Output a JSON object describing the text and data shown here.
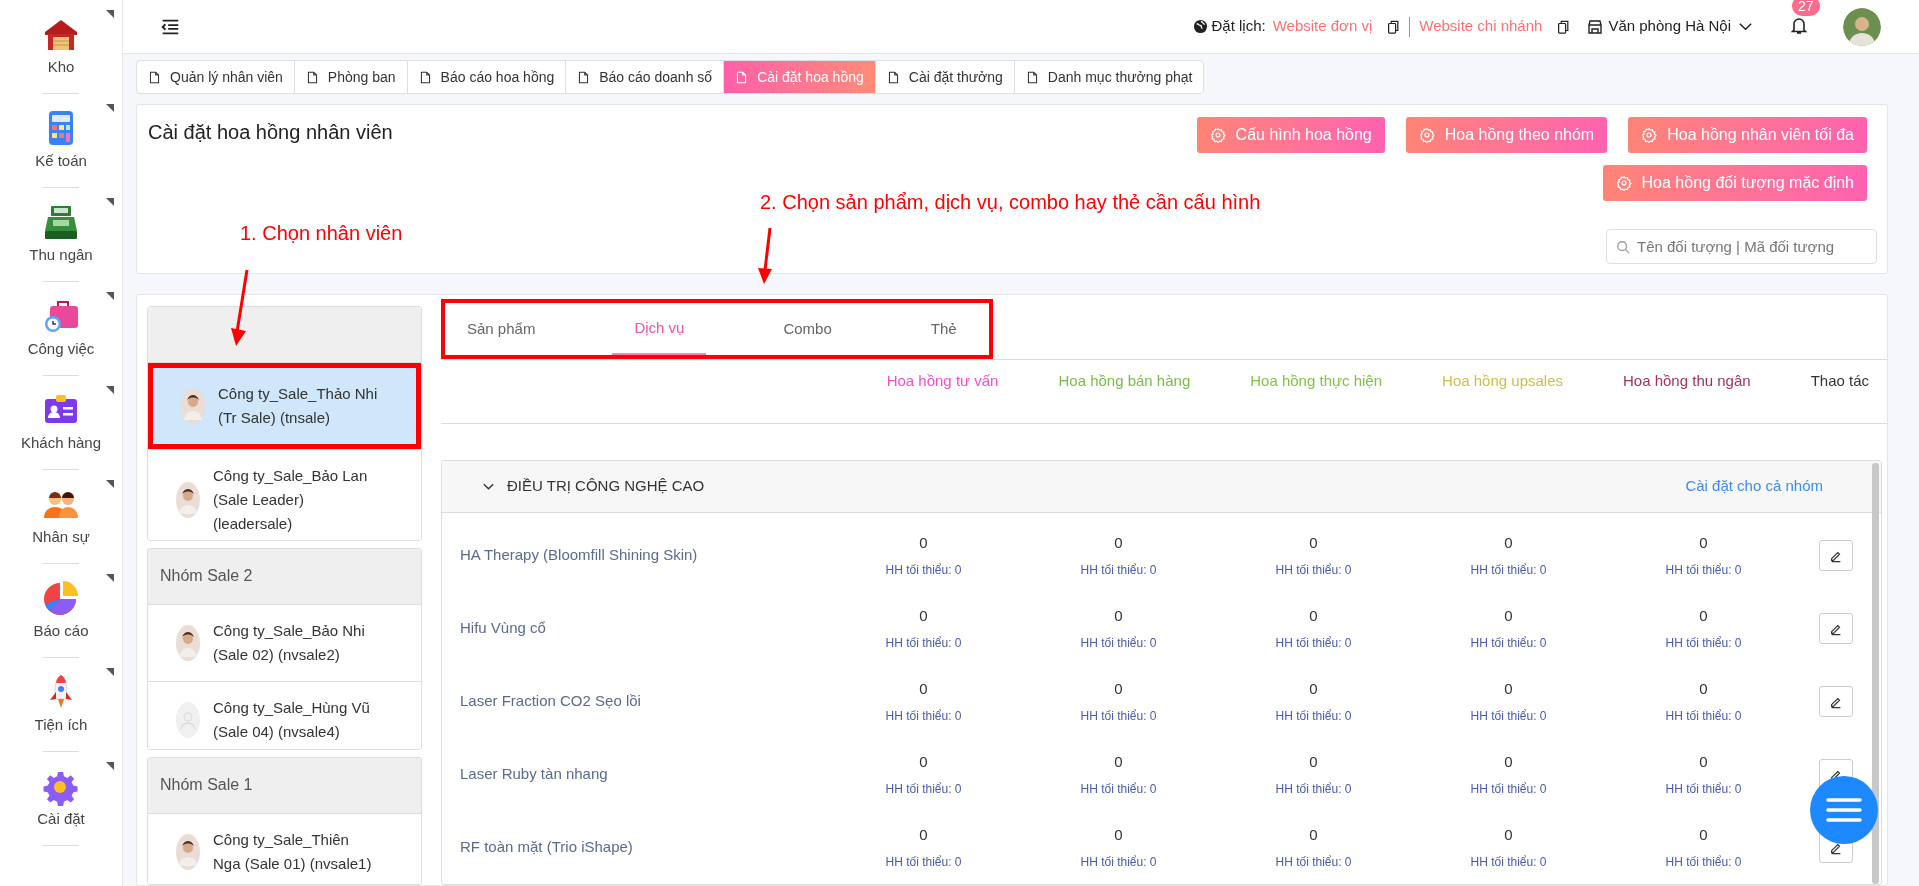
{
  "sidebar": {
    "items": [
      {
        "label": "Kho"
      },
      {
        "label": "Kế toán"
      },
      {
        "label": "Thu ngân"
      },
      {
        "label": "Công việc"
      },
      {
        "label": "Khách hàng"
      },
      {
        "label": "Nhân sự"
      },
      {
        "label": "Báo cáo"
      },
      {
        "label": "Tiện ích"
      },
      {
        "label": "Cài đặt"
      }
    ]
  },
  "topbar": {
    "booking_label": "Đặt lịch:",
    "links": [
      "Website đơn vị",
      "Website chi nhánh"
    ],
    "office": "Văn phòng Hà Nội",
    "notification_count": "27"
  },
  "tabs": [
    {
      "label": "Quản lý nhân viên",
      "selected": false
    },
    {
      "label": "Phòng ban",
      "selected": false
    },
    {
      "label": "Báo cáo hoa hồng",
      "selected": false
    },
    {
      "label": "Báo cáo doanh số",
      "selected": false
    },
    {
      "label": "Cài đặt hoa hồng",
      "selected": true
    },
    {
      "label": "Cài đặt thưởng",
      "selected": false
    },
    {
      "label": "Danh mục thưởng phạt",
      "selected": false
    }
  ],
  "header": {
    "title": "Cài đặt hoa hồng nhân viên",
    "buttons": [
      [
        "Cấu hình hoa hồng",
        "Hoa hồng theo nhóm",
        "Hoa hồng nhân viên tối đa"
      ],
      [
        "Hoa hồng đối tượng mặc định"
      ]
    ],
    "search": {
      "placeholder": "Tên đối tượng | Mã đối tượng"
    }
  },
  "annotations": [
    {
      "text": "1. Chọn nhân viên"
    },
    {
      "text": "2. Chọn sản phẩm, dịch vụ, combo hay thẻ cần cấu hình"
    }
  ],
  "employee_groups": [
    {
      "employees": [
        {
          "name": "Công ty_Sale_Thảo Nhi (Tr Sale) (tnsale)",
          "selected": true,
          "kind": "photo"
        },
        {
          "name": "Công ty_Sale_Bảo Lan (Sale Leader) (leadersale)",
          "selected": false,
          "kind": "photo"
        }
      ]
    },
    {
      "title": "Nhóm Sale 2",
      "employees": [
        {
          "name": "Công ty_Sale_Bảo Nhi (Sale 02) (nvsale2)",
          "selected": false,
          "kind": "photo"
        },
        {
          "name": "Công ty_Sale_Hùng Vũ (Sale 04) (nvsale4)",
          "selected": false,
          "kind": "placeholder"
        }
      ]
    },
    {
      "title": "Nhóm Sale 1",
      "employees": [
        {
          "name": "Công ty_Sale_Thiên Nga (Sale 01) (nvsale1)",
          "selected": false,
          "kind": "photo"
        }
      ]
    }
  ],
  "product_tabs": [
    {
      "label": "Sản phẩm",
      "selected": false
    },
    {
      "label": "Dịch vụ",
      "selected": true
    },
    {
      "label": "Combo",
      "selected": false
    },
    {
      "label": "Thẻ",
      "selected": false
    }
  ],
  "columns": [
    {
      "label": "Hoa hồng tư vấn",
      "color": "#f04fc8"
    },
    {
      "label": "Hoa hồng bán hàng",
      "color": "#7cb84a"
    },
    {
      "label": "Hoa hồng thực hiện",
      "color": "#82c04a"
    },
    {
      "label": "Hoa hồng upsales",
      "color": "#c8c04c"
    },
    {
      "label": "Hoa hồng thu ngân",
      "color": "#a1335e"
    },
    {
      "label": "Thao tác",
      "color": "#333333"
    }
  ],
  "service_group": {
    "title": "ĐIỀU TRỊ CÔNG NGHỆ CAO",
    "expanded": true,
    "action": "Cài đặt cho cả nhóm",
    "rows": [
      {
        "name": "HA Therapy (Bloomfill Shining Skin)",
        "values": [
          {
            "value": "0",
            "min": "HH tối thiểu: 0"
          },
          {
            "value": "0",
            "min": "HH tối thiểu: 0"
          },
          {
            "value": "0",
            "min": "HH tối thiểu: 0"
          },
          {
            "value": "0",
            "min": "HH tối thiểu: 0"
          },
          {
            "value": "0",
            "min": "HH tối thiểu: 0"
          }
        ]
      },
      {
        "name": "Hifu Vùng cổ",
        "values": [
          {
            "value": "0",
            "min": "HH tối thiểu: 0"
          },
          {
            "value": "0",
            "min": "HH tối thiểu: 0"
          },
          {
            "value": "0",
            "min": "HH tối thiểu: 0"
          },
          {
            "value": "0",
            "min": "HH tối thiểu: 0"
          },
          {
            "value": "0",
            "min": "HH tối thiểu: 0"
          }
        ]
      },
      {
        "name": "Laser Fraction CO2 Sẹo lồi",
        "values": [
          {
            "value": "0",
            "min": "HH tối thiểu: 0"
          },
          {
            "value": "0",
            "min": "HH tối thiểu: 0"
          },
          {
            "value": "0",
            "min": "HH tối thiểu: 0"
          },
          {
            "value": "0",
            "min": "HH tối thiểu: 0"
          },
          {
            "value": "0",
            "min": "HH tối thiểu: 0"
          }
        ]
      },
      {
        "name": "Laser Ruby tàn nhang",
        "values": [
          {
            "value": "0",
            "min": "HH tối thiểu: 0"
          },
          {
            "value": "0",
            "min": "HH tối thiểu: 0"
          },
          {
            "value": "0",
            "min": "HH tối thiểu: 0"
          },
          {
            "value": "0",
            "min": "HH tối thiểu: 0"
          },
          {
            "value": "0",
            "min": "HH tối thiểu: 0"
          }
        ]
      },
      {
        "name": "RF toàn mặt (Trio iShape)",
        "values": [
          {
            "value": "0",
            "min": "HH tối thiểu: 0"
          },
          {
            "value": "0",
            "min": "HH tối thiểu: 0"
          },
          {
            "value": "0",
            "min": "HH tối thiểu: 0"
          },
          {
            "value": "0",
            "min": "HH tối thiểu: 0"
          },
          {
            "value": "0",
            "min": "HH tối thiểu: 0"
          }
        ]
      }
    ]
  }
}
